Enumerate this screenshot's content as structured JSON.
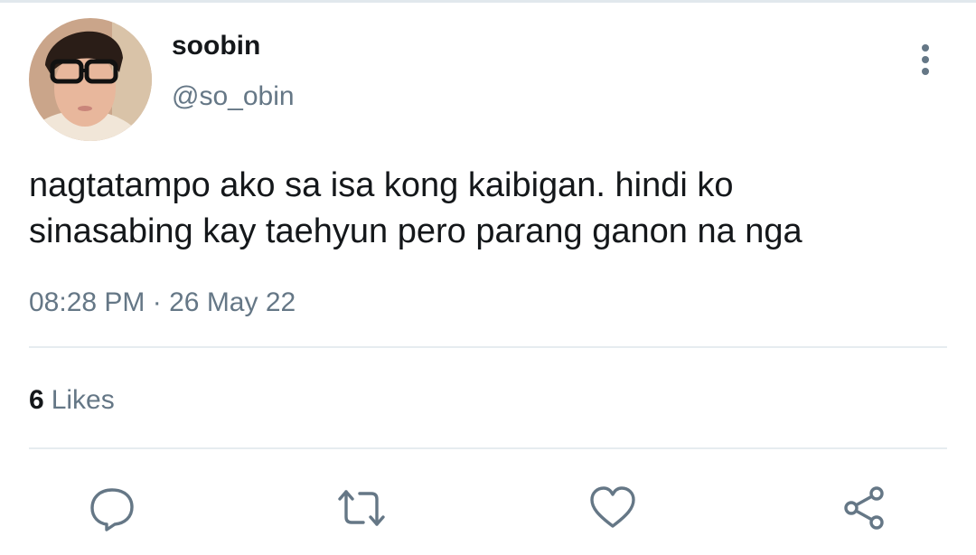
{
  "tweet": {
    "author": {
      "display_name": "soobin",
      "handle": "@so_obin"
    },
    "text_lines": [
      "nagtatampo ako sa isa kong kaibigan. hindi ko",
      "sinasabing kay taehyun pero parang ganon na nga"
    ],
    "time": "08:28 PM",
    "separator": "·",
    "date": "26 May 22",
    "likes": {
      "count": "6",
      "label": "Likes"
    }
  },
  "icons": {
    "more": "more-vertical-icon",
    "reply": "reply-icon",
    "retweet": "retweet-icon",
    "like": "heart-icon",
    "share": "share-icon"
  },
  "colors": {
    "text_primary": "#14171a",
    "text_secondary": "#657786",
    "divider": "#e6ecf0"
  }
}
